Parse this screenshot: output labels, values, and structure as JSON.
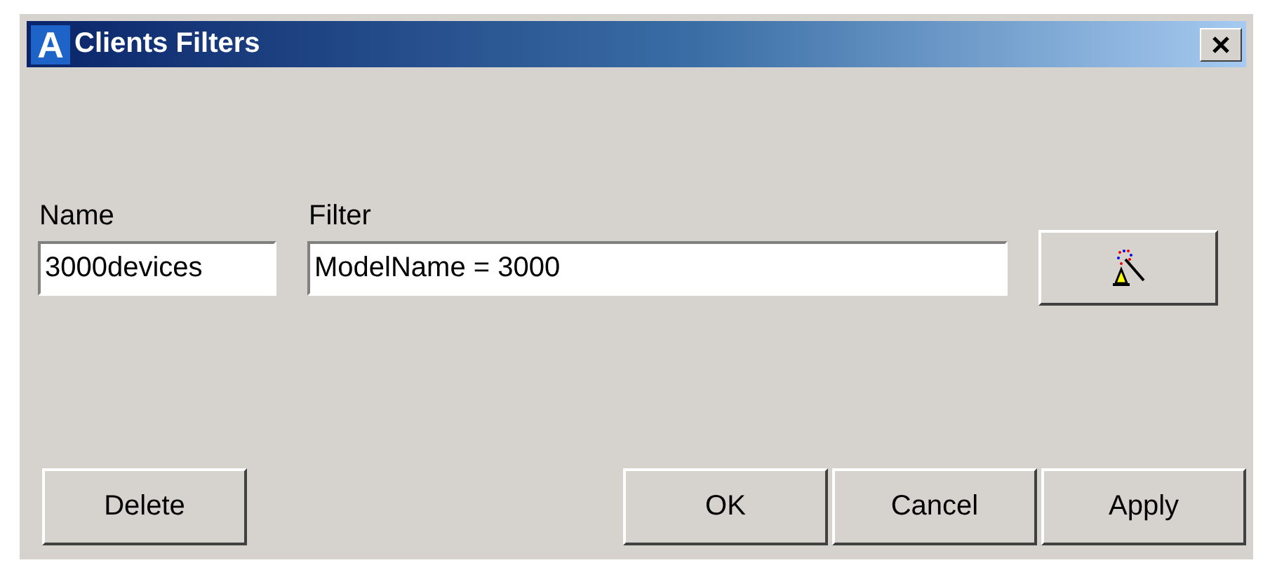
{
  "window": {
    "icon_letter": "A",
    "title": "Clients Filters"
  },
  "fields": [
    {
      "label": "Name",
      "value": "3000devices"
    },
    {
      "label": "Filter",
      "value": "ModelName = 3000"
    }
  ],
  "buttons": [
    "Delete",
    "OK",
    "Cancel",
    "Apply"
  ]
}
